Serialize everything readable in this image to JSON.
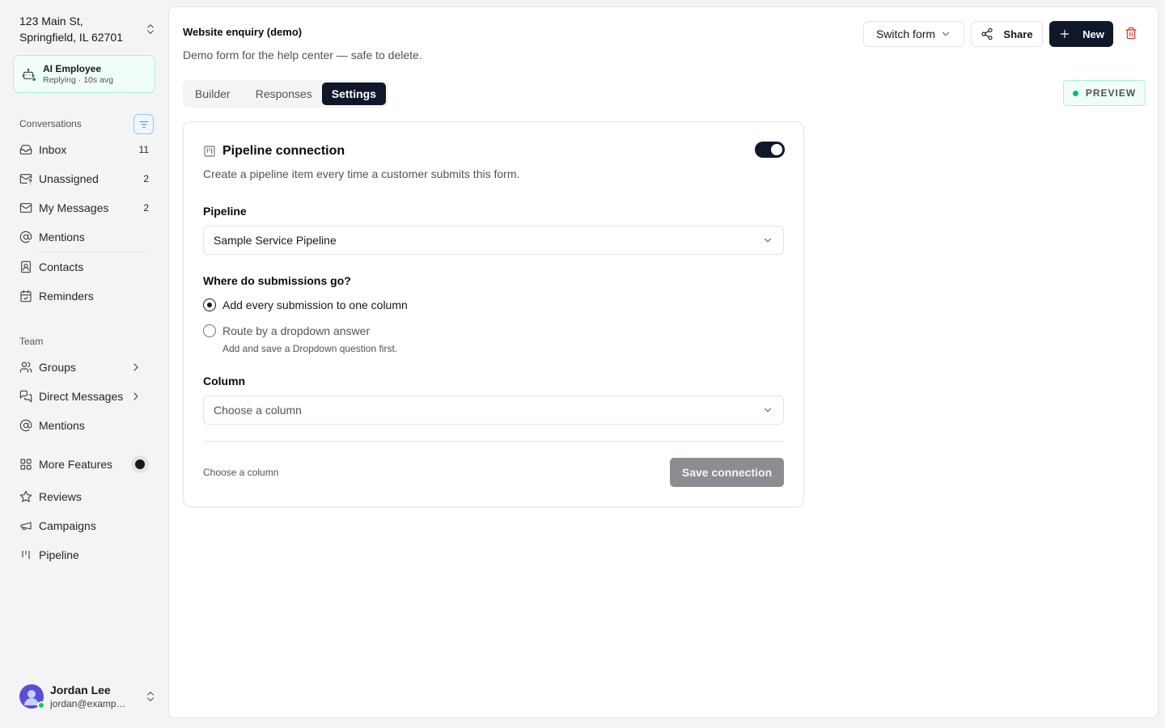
{
  "sidebar": {
    "location": {
      "line1": "123 Main St,",
      "line2": "Springfield, IL 62701"
    },
    "ai_employee": {
      "title": "AI Employee",
      "subtitle": "Replying · 10s avg"
    },
    "conversations_label": "Conversations",
    "conversations": [
      {
        "label": "Inbox",
        "count": "11",
        "icon": "inbox-icon"
      },
      {
        "label": "Unassigned",
        "count": "2",
        "icon": "mail-question-icon"
      },
      {
        "label": "My Messages",
        "count": "2",
        "icon": "mail-icon"
      },
      {
        "label": "Mentions",
        "icon": "at-sign-icon"
      },
      {
        "label": "Contacts",
        "icon": "contact-book-icon"
      },
      {
        "label": "Reminders",
        "icon": "calendar-icon"
      }
    ],
    "team_label": "Team",
    "team": [
      {
        "label": "Groups",
        "icon": "users-icon"
      },
      {
        "label": "Direct Messages",
        "icon": "messages-icon"
      },
      {
        "label": "Mentions",
        "icon": "at-sign-icon"
      }
    ],
    "features": [
      {
        "label": "More Features",
        "icon": "grid-icon"
      },
      {
        "label": "Reviews",
        "icon": "star-icon"
      },
      {
        "label": "Campaigns",
        "icon": "megaphone-icon"
      },
      {
        "label": "Pipeline",
        "icon": "kanban-icon"
      }
    ],
    "user": {
      "name": "Jordan Lee",
      "email": "jordan@example.com"
    }
  },
  "header": {
    "title": "Website enquiry (demo)",
    "description": "Demo form for the help center — safe to delete.",
    "switch_form": "Switch form",
    "share": "Share",
    "new": "New"
  },
  "tabs": [
    {
      "label": "Builder",
      "active": false
    },
    {
      "label": "Responses",
      "active": false
    },
    {
      "label": "Settings",
      "active": true
    }
  ],
  "preview_badge": "PREVIEW",
  "card": {
    "title": "Pipeline connection",
    "enabled": true,
    "description": "Create a pipeline item every time a customer submits this form.",
    "pipeline_label": "Pipeline",
    "pipeline_value": "Sample Service Pipeline",
    "destination_label": "Where do submissions go?",
    "option_one_column": "Add every submission to one column",
    "option_route": "Route by a dropdown answer",
    "option_route_hint": "Add and save a Dropdown question first.",
    "column_label": "Column",
    "column_placeholder": "Choose a column",
    "footer_hint": "Choose a column",
    "save_label": "Save connection"
  },
  "colors": {
    "primary": "#0f172a",
    "accent_green": "#10b981",
    "danger": "#dc2626",
    "disabled_button": "#8b8d93"
  }
}
